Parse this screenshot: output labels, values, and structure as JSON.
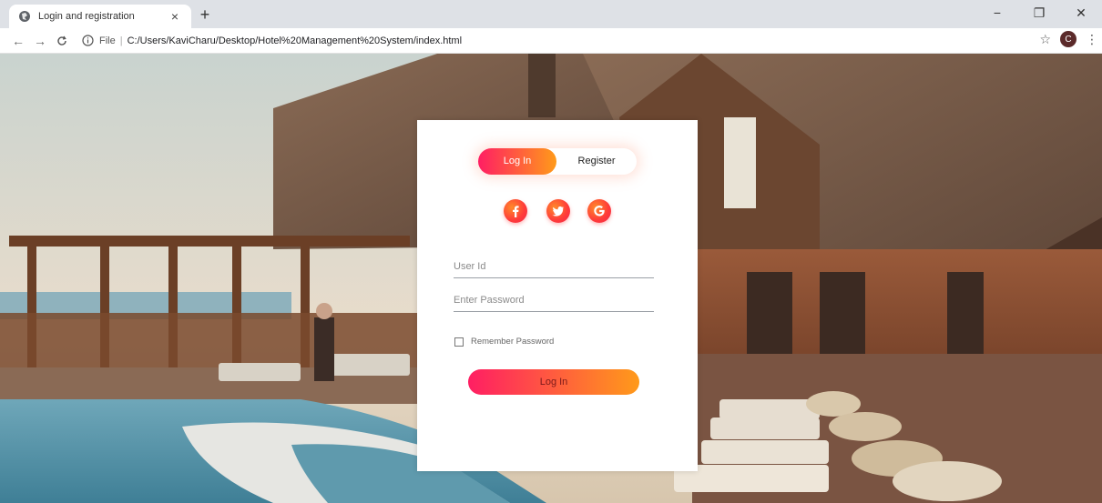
{
  "browser": {
    "tab_title": "Login and registration",
    "tab_close": "×",
    "new_tab": "+",
    "window_controls": {
      "minimize": "−",
      "restore": "❐",
      "close": "✕"
    },
    "nav": {
      "back": "←",
      "forward": "→",
      "reload": "C"
    },
    "address": {
      "scheme_label": "File",
      "separator": "|",
      "url": "C:/Users/KaviCharu/Desktop/Hotel%20Management%20System/index.html"
    },
    "bookmark_icon": "☆",
    "profile_initial": "C",
    "menu_icon": "⋮"
  },
  "login_card": {
    "tabs": {
      "login": "Log In",
      "register": "Register"
    },
    "social_icons": [
      "facebook-icon",
      "twitter-icon",
      "google-icon"
    ],
    "user_id_placeholder": "User Id",
    "password_placeholder": "Enter Password",
    "remember_label": "Remember Password",
    "remember_checked": false,
    "submit_label": "Log In"
  },
  "colors": {
    "gradient_start": "#ff1e63",
    "gradient_end": "#ff9a1a",
    "chrome_tabbar": "#dee1e6"
  }
}
